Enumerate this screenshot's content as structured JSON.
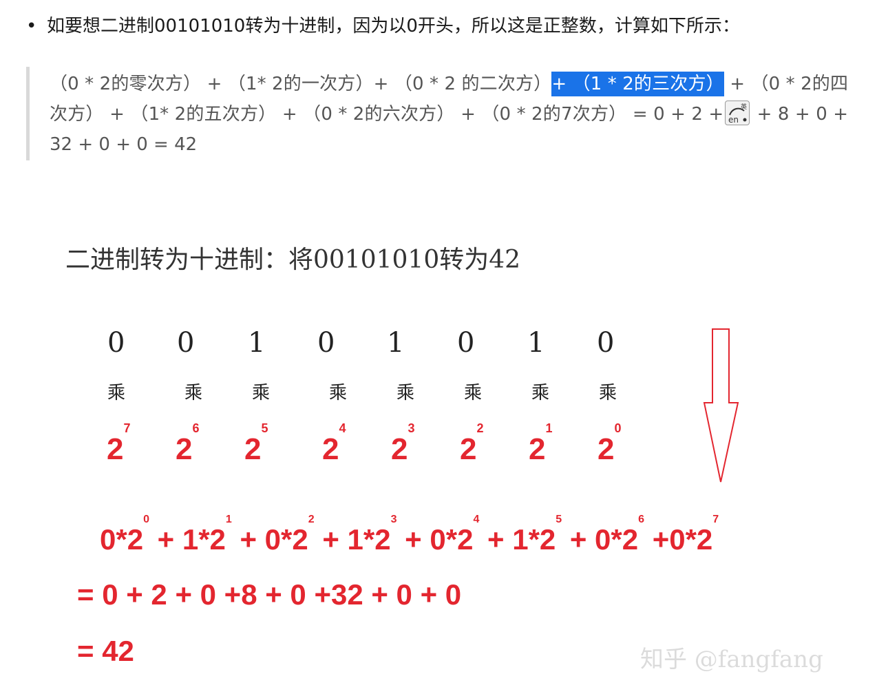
{
  "bullet": {
    "marker": "•",
    "text": "如要想二进制00101010转为十进制，因为以0开头，所以这是正整数，计算如下所示："
  },
  "quote": {
    "before_highlight": "（0 * 2的零次方）  +  （1* 2的一次方）+  （0 * 2 的二次方）",
    "highlighted": "+ （1 * 2的三次方）",
    "after_highlight": "  +  （0 * 2的四次方）  +  （1* 2的五次方）  +  （0 * 2的六次方）  +  （0 * 2的7次方）  = 0 + 2 +",
    "tail": " + 8 + 0 + 32 + 0 + 0 = 42",
    "ime_icon": "ime-en-toggle-icon",
    "ime_icon_top_char": "英",
    "ime_icon_bottom_text": "en"
  },
  "figure": {
    "title": "二进制转为十进制：将00101010转为42",
    "bits": [
      "0",
      "0",
      "1",
      "0",
      "1",
      "0",
      "1",
      "0"
    ],
    "multiply_label": "乘",
    "powers": [
      {
        "base": "2",
        "exp": "7"
      },
      {
        "base": "2",
        "exp": "6"
      },
      {
        "base": "2",
        "exp": "5"
      },
      {
        "base": "2",
        "exp": "4"
      },
      {
        "base": "2",
        "exp": "3"
      },
      {
        "base": "2",
        "exp": "2"
      },
      {
        "base": "2",
        "exp": "1"
      },
      {
        "base": "2",
        "exp": "0"
      }
    ],
    "expansion_terms": [
      {
        "text": "0*2",
        "exp": "0"
      },
      {
        "text": "+ 1*2",
        "exp": "1"
      },
      {
        "text": "+ 0*2",
        "exp": "2"
      },
      {
        "text": "+ 1*2",
        "exp": "3"
      },
      {
        "text": "+ 0*2",
        "exp": "4"
      },
      {
        "text": "+ 1*2",
        "exp": "5"
      },
      {
        "text": "+ 0*2",
        "exp": "6"
      },
      {
        "text": "+0*2",
        "exp": "7"
      }
    ],
    "sum_line": "= 0 + 2 + 0 +8 + 0 +32 + 0 + 0",
    "result_line": "= 42",
    "watermark": "知乎 @fangfang",
    "accent_color": "#e3262f",
    "arrow_icon": "down-arrow-icon"
  },
  "colors": {
    "highlight_bg": "#1a73e8",
    "quote_bar": "#d9d9d9"
  }
}
